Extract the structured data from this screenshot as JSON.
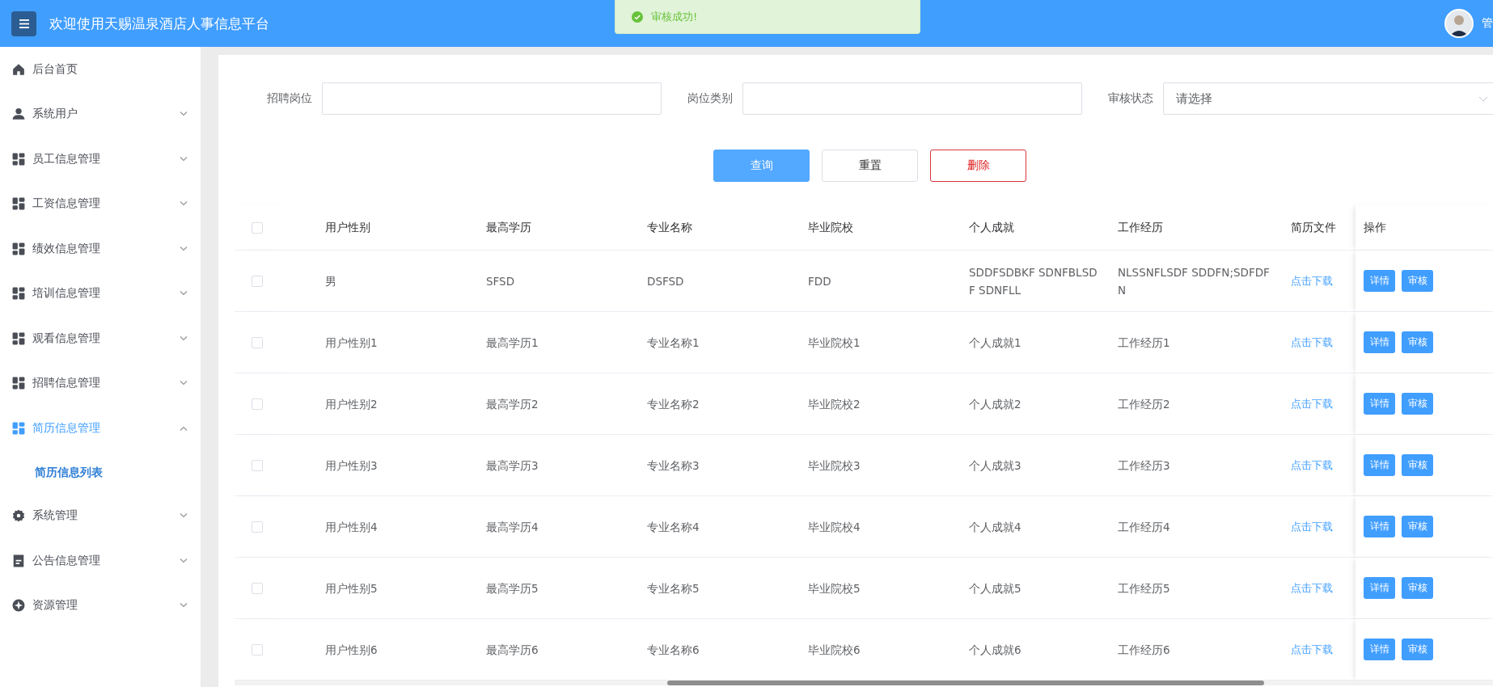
{
  "header": {
    "title": "欢迎使用天赐温泉酒店人事信息平台",
    "user": "管"
  },
  "toast": {
    "message": "审核成功!"
  },
  "sidebar": {
    "items": [
      {
        "label": "后台首页",
        "selected": false
      },
      {
        "label": "系统用户",
        "selected": false,
        "expanded": false
      },
      {
        "label": "员工信息管理",
        "selected": false,
        "expanded": false
      },
      {
        "label": "工资信息管理",
        "selected": false,
        "expanded": false
      },
      {
        "label": "绩效信息管理",
        "selected": false,
        "expanded": false
      },
      {
        "label": "培训信息管理",
        "selected": false,
        "expanded": false
      },
      {
        "label": "观看信息管理",
        "selected": false,
        "expanded": false
      },
      {
        "label": "招聘信息管理",
        "selected": false,
        "expanded": false
      },
      {
        "label": "简历信息管理",
        "selected": true,
        "expanded": true,
        "children": [
          {
            "label": "简历信息列表",
            "selected": true
          }
        ]
      },
      {
        "label": "系统管理",
        "selected": false,
        "expanded": false
      },
      {
        "label": "公告信息管理",
        "selected": false,
        "expanded": false
      },
      {
        "label": "资源管理",
        "selected": false,
        "expanded": false
      }
    ]
  },
  "filters": [
    {
      "label": "招聘岗位",
      "kind": "input"
    },
    {
      "label": "岗位类别",
      "kind": "input"
    },
    {
      "label": "审核状态",
      "kind": "select",
      "placeholder": "请选择"
    }
  ],
  "buttons": [
    {
      "label": "查询",
      "kind": "primary"
    },
    {
      "label": "重置",
      "kind": "default"
    },
    {
      "label": "删除",
      "kind": "danger"
    }
  ],
  "table": {
    "checked": false,
    "columns": [
      "用户性别",
      "最高学历",
      "专业名称",
      "毕业院校",
      "个人成就",
      "工作经历",
      "简历文件",
      "操作"
    ],
    "rows": [
      {
        "checked": false,
        "cells": [
          "男",
          "SFSD",
          "DSFSD",
          "FDD",
          "SDDFSDBKF SDNFBLSDF SDNFLL",
          "NLSSNFLSDF SDDFN;SDFDFN"
        ],
        "file": "点击下载",
        "actions": [
          "详情",
          "审核"
        ]
      },
      {
        "checked": false,
        "cells": [
          "用户性别1",
          "最高学历1",
          "专业名称1",
          "毕业院校1",
          "个人成就1",
          "工作经历1"
        ],
        "file": "点击下载",
        "actions": [
          "详情",
          "审核"
        ]
      },
      {
        "checked": false,
        "cells": [
          "用户性别2",
          "最高学历2",
          "专业名称2",
          "毕业院校2",
          "个人成就2",
          "工作经历2"
        ],
        "file": "点击下载",
        "actions": [
          "详情",
          "审核"
        ]
      },
      {
        "checked": false,
        "cells": [
          "用户性别3",
          "最高学历3",
          "专业名称3",
          "毕业院校3",
          "个人成就3",
          "工作经历3"
        ],
        "file": "点击下载",
        "actions": [
          "详情",
          "审核"
        ]
      },
      {
        "checked": false,
        "cells": [
          "用户性别4",
          "最高学历4",
          "专业名称4",
          "毕业院校4",
          "个人成就4",
          "工作经历4"
        ],
        "file": "点击下载",
        "actions": [
          "详情",
          "审核"
        ]
      },
      {
        "checked": false,
        "cells": [
          "用户性别5",
          "最高学历5",
          "专业名称5",
          "毕业院校5",
          "个人成就5",
          "工作经历5"
        ],
        "file": "点击下载",
        "actions": [
          "详情",
          "审核"
        ]
      },
      {
        "checked": false,
        "cells": [
          "用户性别6",
          "最高学历6",
          "专业名称6",
          "毕业院校6",
          "个人成就6",
          "工作经历6"
        ],
        "file": "点击下载",
        "actions": [
          "详情",
          "审核"
        ]
      }
    ]
  }
}
